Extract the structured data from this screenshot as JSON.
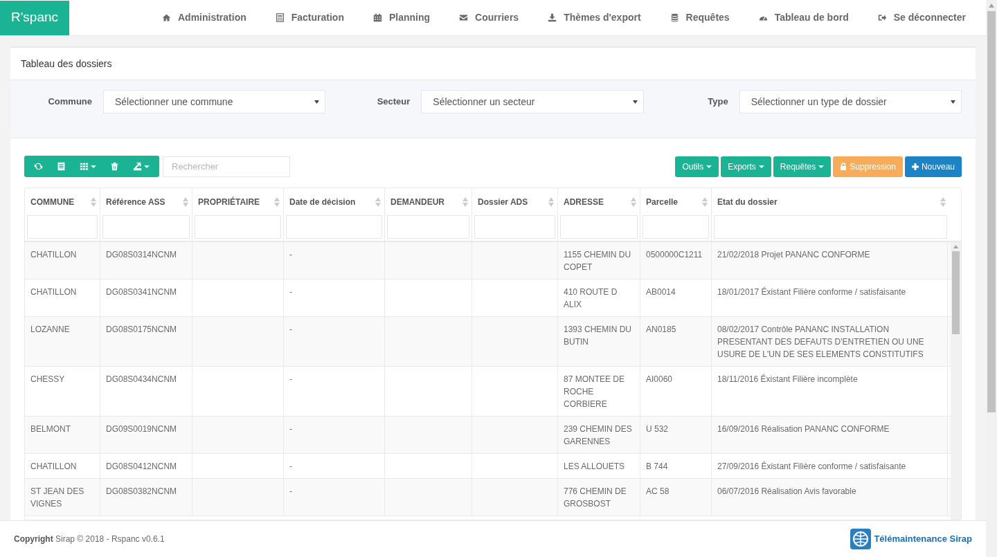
{
  "brand": "R'spanc",
  "nav": [
    {
      "label": "Administration"
    },
    {
      "label": "Facturation"
    },
    {
      "label": "Planning"
    },
    {
      "label": "Courriers"
    },
    {
      "label": "Thèmes d'export"
    },
    {
      "label": "Requêtes"
    },
    {
      "label": "Tableau de bord"
    },
    {
      "label": "Se déconnecter"
    }
  ],
  "panel_title": "Tableau des dossiers",
  "filters": [
    {
      "label": "Commune",
      "placeholder": "Sélectionner une commune"
    },
    {
      "label": "Secteur",
      "placeholder": "Sélectionner un secteur"
    },
    {
      "label": "Type",
      "placeholder": "Sélectionner un type de dossier"
    }
  ],
  "search": {
    "placeholder": "Rechercher"
  },
  "actions": [
    {
      "label": "Outils",
      "kind": "menu",
      "color": "#1ab394"
    },
    {
      "label": "Exports",
      "kind": "menu",
      "color": "#1ab394"
    },
    {
      "label": "Requêtes",
      "kind": "menu",
      "color": "#1ab394"
    },
    {
      "label": "Suppression",
      "kind": "lock",
      "color": "#f8ac59"
    },
    {
      "label": "Nouveau",
      "kind": "plus",
      "color": "#1c84c6"
    }
  ],
  "table": {
    "columns": [
      "COMMUNE",
      "Référence ASS",
      "PROPRIÉTAIRE",
      "Date de décision",
      "DEMANDEUR",
      "Dossier ADS",
      "ADRESSE",
      "Parcelle",
      "Etat du dossier"
    ],
    "rows": [
      {
        "cells": [
          "CHATILLON",
          "DG08S0314NCNM",
          "",
          "-",
          "",
          "",
          "1155 CHEMIN DU COPET",
          "0500000C1211",
          "21/02/2018 Projet PANANC CONFORME"
        ]
      },
      {
        "cells": [
          "CHATILLON",
          "DG08S0341NCNM",
          "",
          "-",
          "",
          "",
          "410 ROUTE D ALIX",
          "AB0014",
          "18/01/2017 Éxistant Filière conforme / satisfaisante"
        ]
      },
      {
        "cells": [
          "LOZANNE",
          "DG08S0175NCNM",
          "",
          "-",
          "",
          "",
          "1393 CHEMIN DU BUTIN",
          "AN0185",
          "08/02/2017 Contrôle PANANC INSTALLATION PRESENTANT DES DEFAUTS D'ENTRETIEN OU UNE USURE DE L'UN DE SES ELEMENTS CONSTITUTIFS"
        ]
      },
      {
        "cells": [
          "CHESSY",
          "DG08S0434NCNM",
          "",
          "-",
          "",
          "",
          "87 MONTEE DE ROCHE CORBIERE",
          "AI0060",
          "18/11/2016 Éxistant Filière incomplète"
        ]
      },
      {
        "cells": [
          "BELMONT",
          "DG09S0019NCNM",
          "",
          "-",
          "",
          "",
          "239 CHEMIN DES GARENNES",
          "U 532",
          "16/09/2016 Réalisation PANANC CONFORME"
        ]
      },
      {
        "cells": [
          "CHATILLON",
          "DG08S0412NCNM",
          "",
          "-",
          "",
          "",
          "LES ALLOUETS",
          "B 744",
          "27/09/2016 Éxistant Filière conforme / satisfaisante"
        ]
      },
      {
        "cells": [
          "ST JEAN DES VIGNES",
          "DG08S0382NCNM",
          "",
          "-",
          "",
          "",
          "776 CHEMIN DE GROSBOST",
          "AC 58",
          "06/07/2016 Réalisation Avis favorable"
        ]
      }
    ]
  },
  "footer": {
    "copyright_label": "Copyright",
    "copyright_text": "Sirap © 2018 - Rspanc v0.6.1",
    "support_link": "Télémaintenance Sirap"
  }
}
